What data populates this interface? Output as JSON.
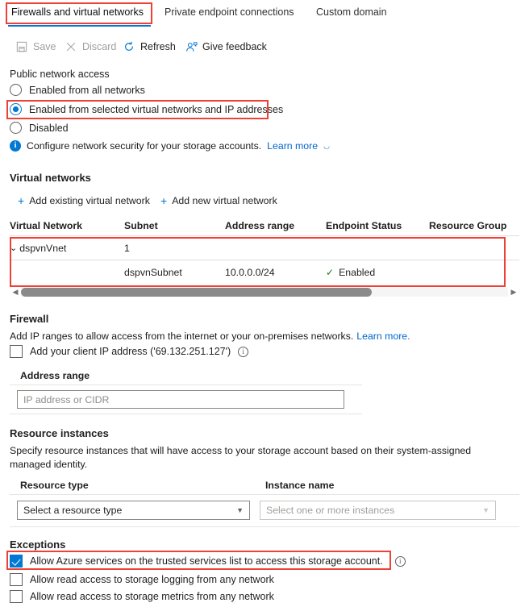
{
  "tabs": [
    {
      "label": "Firewalls and virtual networks",
      "active": true
    },
    {
      "label": "Private endpoint connections",
      "active": false
    },
    {
      "label": "Custom domain",
      "active": false
    }
  ],
  "commandbar": {
    "save_label": "Save",
    "discard_label": "Discard",
    "refresh_label": "Refresh",
    "feedback_label": "Give feedback"
  },
  "public_network_access": {
    "title": "Public network access",
    "options": [
      {
        "label": "Enabled from all networks",
        "selected": false
      },
      {
        "label": "Enabled from selected virtual networks and IP addresses",
        "selected": true
      },
      {
        "label": "Disabled",
        "selected": false
      }
    ],
    "info_text": "Configure network security for your storage accounts.",
    "info_link": "Learn more",
    "info_icon": "info-circle-icon",
    "external_icon": "external-link-icon"
  },
  "virtual_networks": {
    "title": "Virtual networks",
    "add_existing_label": "Add existing virtual network",
    "add_new_label": "Add new virtual network",
    "columns": [
      "Virtual Network",
      "Subnet",
      "Address range",
      "Endpoint Status",
      "Resource Group"
    ],
    "rows": [
      {
        "type": "group",
        "chevron": "chevron-down-icon",
        "virtual_network": "dspvnVnet",
        "subnet": "1",
        "address_range": "",
        "endpoint_status": "",
        "resource_group": ""
      },
      {
        "type": "child",
        "virtual_network": "",
        "subnet": "dspvnSubnet",
        "address_range": "10.0.0.0/24",
        "endpoint_status": "Enabled",
        "endpoint_status_icon": "checkmark-icon",
        "resource_group": ""
      }
    ],
    "scroll_left_icon": "scroll-left-arrow-icon",
    "scroll_right_icon": "scroll-right-arrow-icon"
  },
  "firewall": {
    "title": "Firewall",
    "description": "Add IP ranges to allow access from the internet or your on-premises networks.",
    "description_link": "Learn more.",
    "client_ip_label": "Add your client IP address ('69.132.251.127')",
    "client_ip_checked": false,
    "client_ip_info_icon": "info-outline-icon",
    "address_range_label": "Address range",
    "address_range_value": "",
    "address_range_placeholder": "IP address or CIDR"
  },
  "resource_instances": {
    "title": "Resource instances",
    "description": "Specify resource instances that will have access to your storage account based on their system-assigned managed identity.",
    "resource_type_label": "Resource type",
    "resource_type_value": "Select a resource type",
    "instance_name_label": "Instance name",
    "instance_name_value": "Select one or more instances",
    "caret_icon": "chevron-down-icon"
  },
  "exceptions": {
    "title": "Exceptions",
    "items": [
      {
        "label": "Allow Azure services on the trusted services list to access this storage account.",
        "checked": true,
        "info_icon": "info-outline-icon",
        "highlighted": true
      },
      {
        "label": "Allow read access to storage logging from any network",
        "checked": false,
        "highlighted": false
      },
      {
        "label": "Allow read access to storage metrics from any network",
        "checked": false,
        "highlighted": false
      }
    ]
  },
  "colors": {
    "accent": "#0078d4",
    "annotation": "#ef4036",
    "success": "#107c10",
    "link": "#0066cc"
  }
}
